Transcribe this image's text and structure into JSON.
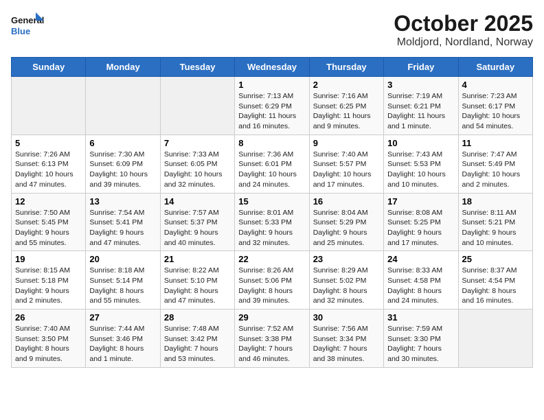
{
  "header": {
    "logo_line1": "General",
    "logo_line2": "Blue",
    "title": "October 2025",
    "subtitle": "Moldjord, Nordland, Norway"
  },
  "weekdays": [
    "Sunday",
    "Monday",
    "Tuesday",
    "Wednesday",
    "Thursday",
    "Friday",
    "Saturday"
  ],
  "weeks": [
    [
      {
        "day": "",
        "info": ""
      },
      {
        "day": "",
        "info": ""
      },
      {
        "day": "",
        "info": ""
      },
      {
        "day": "1",
        "info": "Sunrise: 7:13 AM\nSunset: 6:29 PM\nDaylight: 11 hours\nand 16 minutes."
      },
      {
        "day": "2",
        "info": "Sunrise: 7:16 AM\nSunset: 6:25 PM\nDaylight: 11 hours\nand 9 minutes."
      },
      {
        "day": "3",
        "info": "Sunrise: 7:19 AM\nSunset: 6:21 PM\nDaylight: 11 hours\nand 1 minute."
      },
      {
        "day": "4",
        "info": "Sunrise: 7:23 AM\nSunset: 6:17 PM\nDaylight: 10 hours\nand 54 minutes."
      }
    ],
    [
      {
        "day": "5",
        "info": "Sunrise: 7:26 AM\nSunset: 6:13 PM\nDaylight: 10 hours\nand 47 minutes."
      },
      {
        "day": "6",
        "info": "Sunrise: 7:30 AM\nSunset: 6:09 PM\nDaylight: 10 hours\nand 39 minutes."
      },
      {
        "day": "7",
        "info": "Sunrise: 7:33 AM\nSunset: 6:05 PM\nDaylight: 10 hours\nand 32 minutes."
      },
      {
        "day": "8",
        "info": "Sunrise: 7:36 AM\nSunset: 6:01 PM\nDaylight: 10 hours\nand 24 minutes."
      },
      {
        "day": "9",
        "info": "Sunrise: 7:40 AM\nSunset: 5:57 PM\nDaylight: 10 hours\nand 17 minutes."
      },
      {
        "day": "10",
        "info": "Sunrise: 7:43 AM\nSunset: 5:53 PM\nDaylight: 10 hours\nand 10 minutes."
      },
      {
        "day": "11",
        "info": "Sunrise: 7:47 AM\nSunset: 5:49 PM\nDaylight: 10 hours\nand 2 minutes."
      }
    ],
    [
      {
        "day": "12",
        "info": "Sunrise: 7:50 AM\nSunset: 5:45 PM\nDaylight: 9 hours\nand 55 minutes."
      },
      {
        "day": "13",
        "info": "Sunrise: 7:54 AM\nSunset: 5:41 PM\nDaylight: 9 hours\nand 47 minutes."
      },
      {
        "day": "14",
        "info": "Sunrise: 7:57 AM\nSunset: 5:37 PM\nDaylight: 9 hours\nand 40 minutes."
      },
      {
        "day": "15",
        "info": "Sunrise: 8:01 AM\nSunset: 5:33 PM\nDaylight: 9 hours\nand 32 minutes."
      },
      {
        "day": "16",
        "info": "Sunrise: 8:04 AM\nSunset: 5:29 PM\nDaylight: 9 hours\nand 25 minutes."
      },
      {
        "day": "17",
        "info": "Sunrise: 8:08 AM\nSunset: 5:25 PM\nDaylight: 9 hours\nand 17 minutes."
      },
      {
        "day": "18",
        "info": "Sunrise: 8:11 AM\nSunset: 5:21 PM\nDaylight: 9 hours\nand 10 minutes."
      }
    ],
    [
      {
        "day": "19",
        "info": "Sunrise: 8:15 AM\nSunset: 5:18 PM\nDaylight: 9 hours\nand 2 minutes."
      },
      {
        "day": "20",
        "info": "Sunrise: 8:18 AM\nSunset: 5:14 PM\nDaylight: 8 hours\nand 55 minutes."
      },
      {
        "day": "21",
        "info": "Sunrise: 8:22 AM\nSunset: 5:10 PM\nDaylight: 8 hours\nand 47 minutes."
      },
      {
        "day": "22",
        "info": "Sunrise: 8:26 AM\nSunset: 5:06 PM\nDaylight: 8 hours\nand 39 minutes."
      },
      {
        "day": "23",
        "info": "Sunrise: 8:29 AM\nSunset: 5:02 PM\nDaylight: 8 hours\nand 32 minutes."
      },
      {
        "day": "24",
        "info": "Sunrise: 8:33 AM\nSunset: 4:58 PM\nDaylight: 8 hours\nand 24 minutes."
      },
      {
        "day": "25",
        "info": "Sunrise: 8:37 AM\nSunset: 4:54 PM\nDaylight: 8 hours\nand 16 minutes."
      }
    ],
    [
      {
        "day": "26",
        "info": "Sunrise: 7:40 AM\nSunset: 3:50 PM\nDaylight: 8 hours\nand 9 minutes."
      },
      {
        "day": "27",
        "info": "Sunrise: 7:44 AM\nSunset: 3:46 PM\nDaylight: 8 hours\nand 1 minute."
      },
      {
        "day": "28",
        "info": "Sunrise: 7:48 AM\nSunset: 3:42 PM\nDaylight: 7 hours\nand 53 minutes."
      },
      {
        "day": "29",
        "info": "Sunrise: 7:52 AM\nSunset: 3:38 PM\nDaylight: 7 hours\nand 46 minutes."
      },
      {
        "day": "30",
        "info": "Sunrise: 7:56 AM\nSunset: 3:34 PM\nDaylight: 7 hours\nand 38 minutes."
      },
      {
        "day": "31",
        "info": "Sunrise: 7:59 AM\nSunset: 3:30 PM\nDaylight: 7 hours\nand 30 minutes."
      },
      {
        "day": "",
        "info": ""
      }
    ]
  ]
}
